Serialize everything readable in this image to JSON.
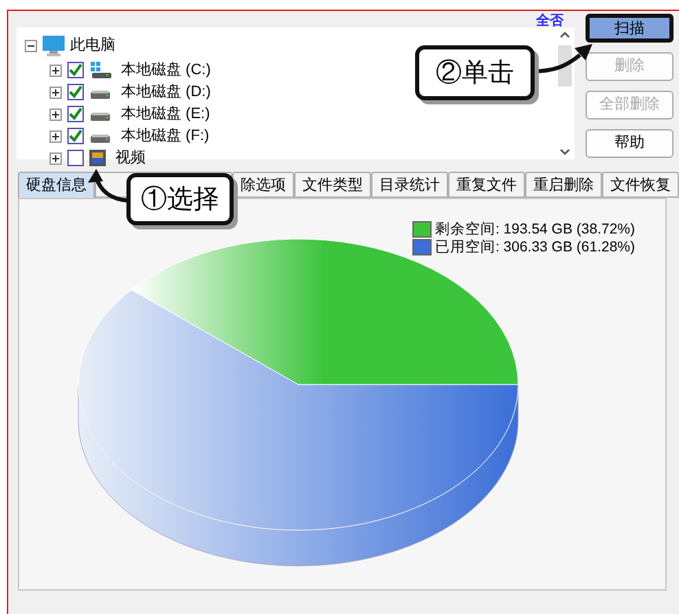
{
  "tree": {
    "label": "此电脑",
    "expanded": true,
    "children": [
      {
        "label": "本地磁盘 (C:)",
        "checked": true,
        "kind": "system"
      },
      {
        "label": "本地磁盘 (D:)",
        "checked": true,
        "kind": "drive"
      },
      {
        "label": "本地磁盘 (E:)",
        "checked": true,
        "kind": "drive"
      },
      {
        "label": "本地磁盘 (F:)",
        "checked": true,
        "kind": "drive"
      },
      {
        "label": "视频",
        "checked": false,
        "kind": "video"
      }
    ]
  },
  "select_none_link": "全否",
  "buttons": [
    {
      "label": "扫描",
      "disabled": false,
      "selected": true
    },
    {
      "label": "删除",
      "disabled": true,
      "selected": false
    },
    {
      "label": "全部删除",
      "disabled": true,
      "selected": false
    },
    {
      "label": "帮助",
      "disabled": false,
      "selected": false
    }
  ],
  "tabs": [
    {
      "label": "硬盘信息",
      "selected": true
    },
    {
      "selected": false
    },
    {
      "label": "除选项",
      "selected": false
    },
    {
      "label": "文件类型",
      "selected": false
    },
    {
      "label": "目录统计",
      "selected": false
    },
    {
      "label": "重复文件",
      "selected": false
    },
    {
      "label": "重启删除",
      "selected": false
    },
    {
      "label": "文件恢复",
      "selected": false
    }
  ],
  "legend": [
    {
      "text": "剩余空间: 193.54 GB (38.72%)",
      "color": "#3cc43c"
    },
    {
      "text": "已用空间: 306.33 GB (61.28%)",
      "color": "#3b6fd8"
    }
  ],
  "chart_data": {
    "type": "pie",
    "values": [
      38.72,
      61.28
    ]
  },
  "callouts": [
    {
      "text": "①选择"
    },
    {
      "text": "②单击"
    }
  ]
}
